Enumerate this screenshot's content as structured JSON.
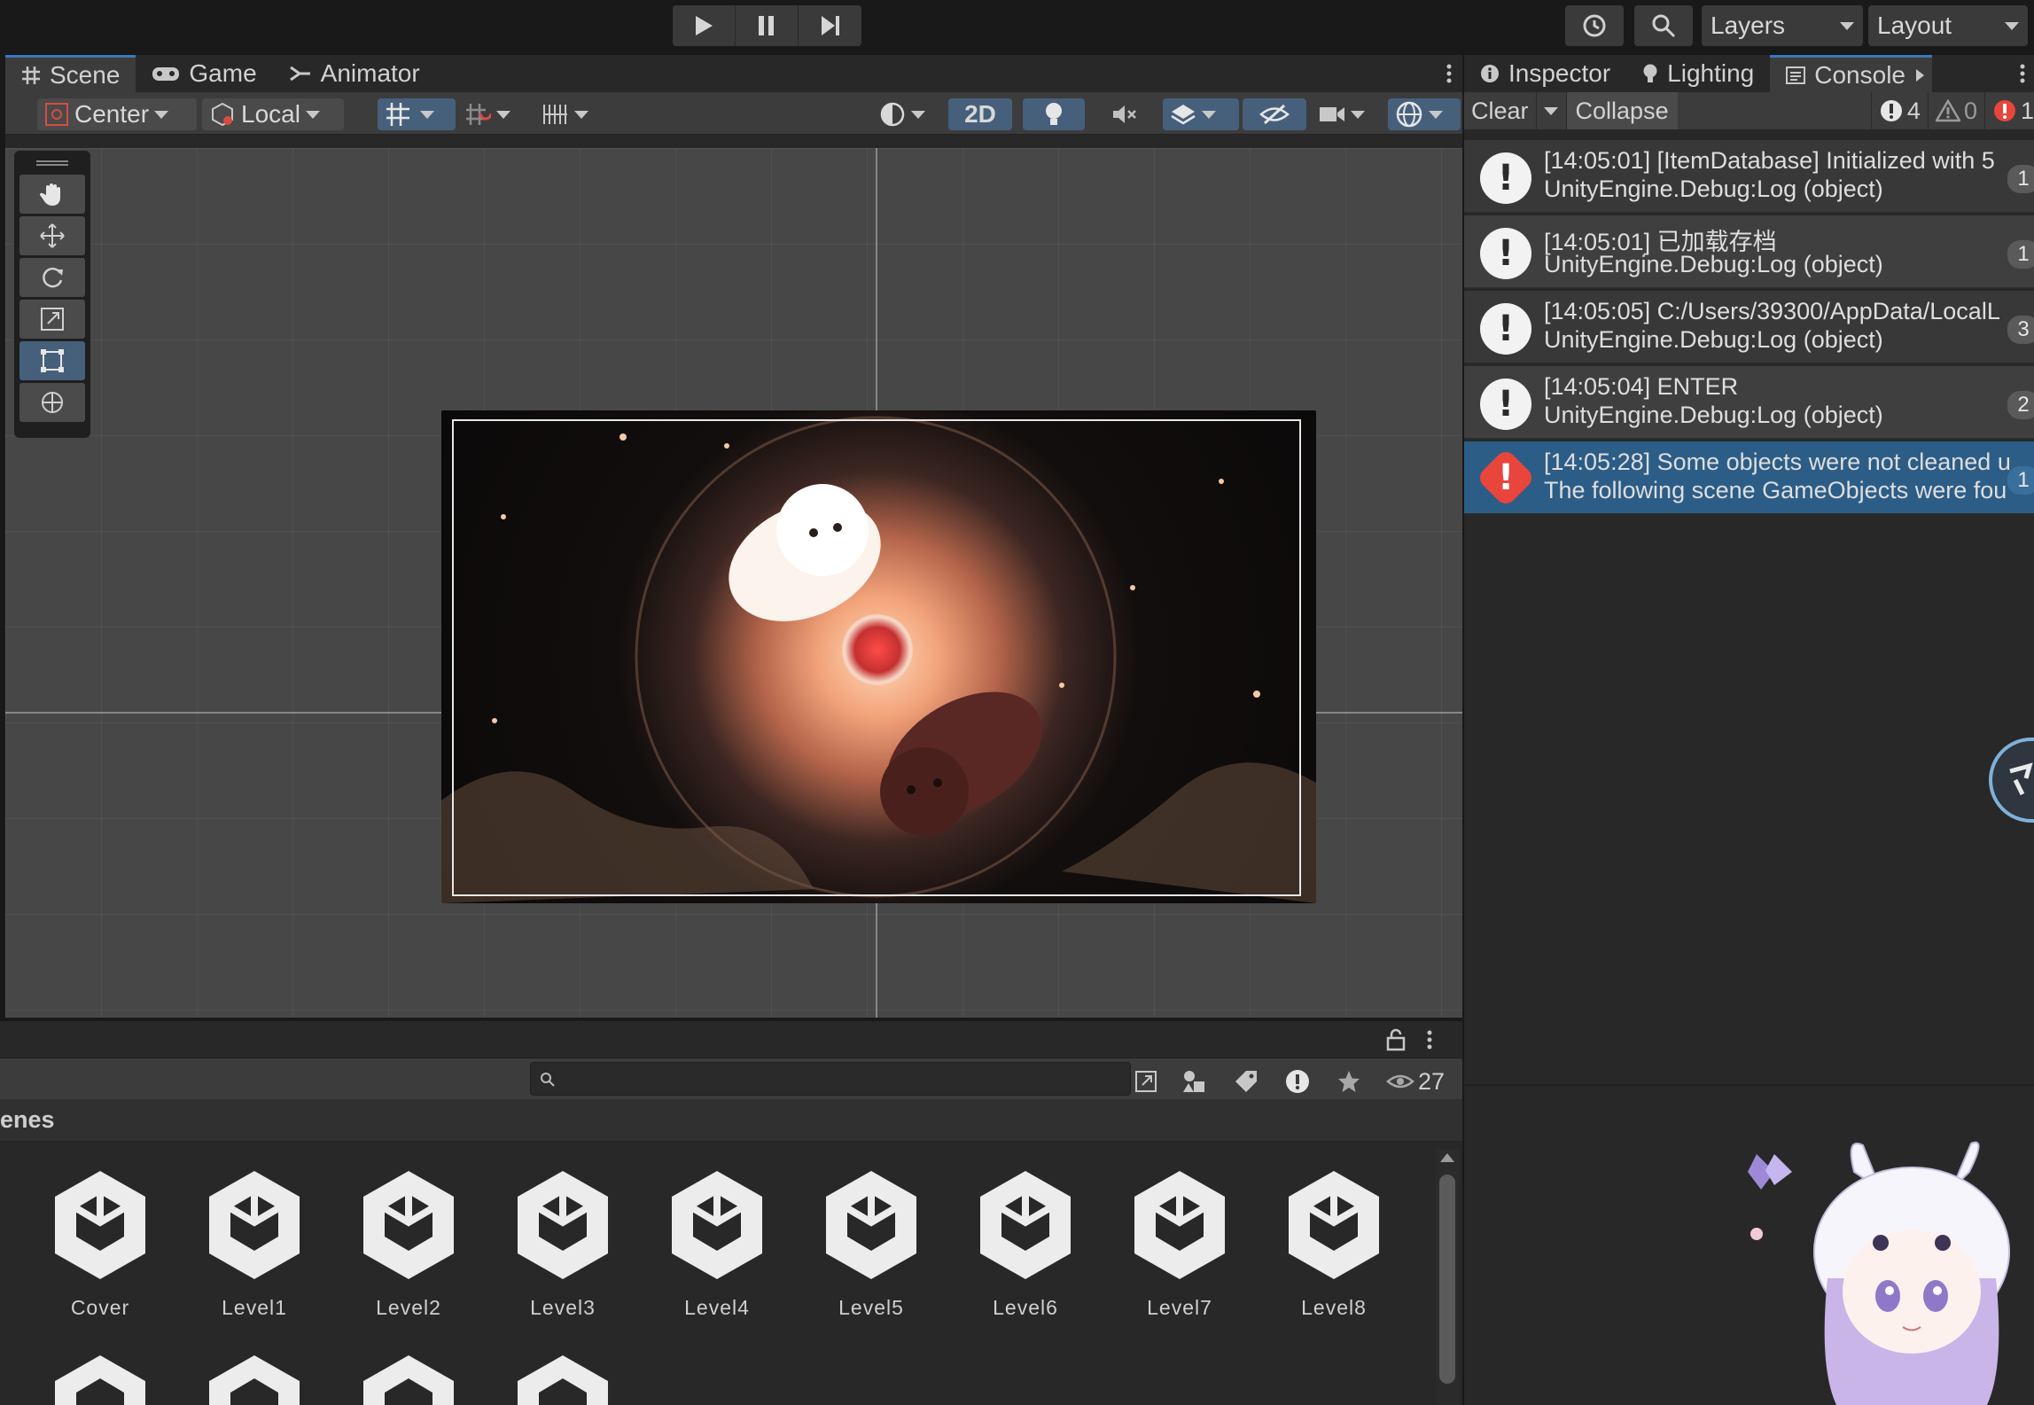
{
  "toolbar": {
    "layers_label": "Layers",
    "layout_label": "Layout"
  },
  "scene_tabs": [
    {
      "label": "Scene",
      "icon": "grid-icon"
    },
    {
      "label": "Game",
      "icon": "gamepad-icon"
    },
    {
      "label": "Animator",
      "icon": "animator-icon"
    }
  ],
  "scene_toolbar": {
    "pivot_label": "Center",
    "space_label": "Local",
    "mode_2d": "2D"
  },
  "right_tabs": [
    {
      "label": "Inspector",
      "icon": "info-icon"
    },
    {
      "label": "Lighting",
      "icon": "bulb-icon"
    },
    {
      "label": "Console",
      "icon": "console-icon"
    }
  ],
  "console_toolbar": {
    "clear_label": "Clear",
    "collapse_label": "Collapse",
    "log_count": "4",
    "warn_count": "0",
    "error_count": "1"
  },
  "console_entries": [
    {
      "line1": "[14:05:01] [ItemDatabase] Initialized with 5",
      "line2": "UnityEngine.Debug:Log (object)",
      "count": "1",
      "type": "log"
    },
    {
      "line1": "[14:05:01] 已加载存档",
      "line2": "UnityEngine.Debug:Log (object)",
      "count": "1",
      "type": "log"
    },
    {
      "line1": "[14:05:05] C:/Users/39300/AppData/LocalL",
      "line2": "UnityEngine.Debug:Log (object)",
      "count": "3",
      "type": "log"
    },
    {
      "line1": "[14:05:04] ENTER",
      "line2": "UnityEngine.Debug:Log (object)",
      "count": "2",
      "type": "log"
    },
    {
      "line1": "[14:05:28] Some objects were not cleaned u",
      "line2": "The following scene GameObjects were fou",
      "count": "1",
      "type": "error"
    }
  ],
  "project": {
    "visible_count": "27",
    "breadcrumb": "enes",
    "assets": [
      "Cover",
      "Level1",
      "Level2",
      "Level3",
      "Level4",
      "Level5",
      "Level6",
      "Level7",
      "Level8"
    ]
  },
  "colors": {
    "accent": "#3a79bb",
    "selected_row": "#2c5d87",
    "error": "#e8453c"
  }
}
